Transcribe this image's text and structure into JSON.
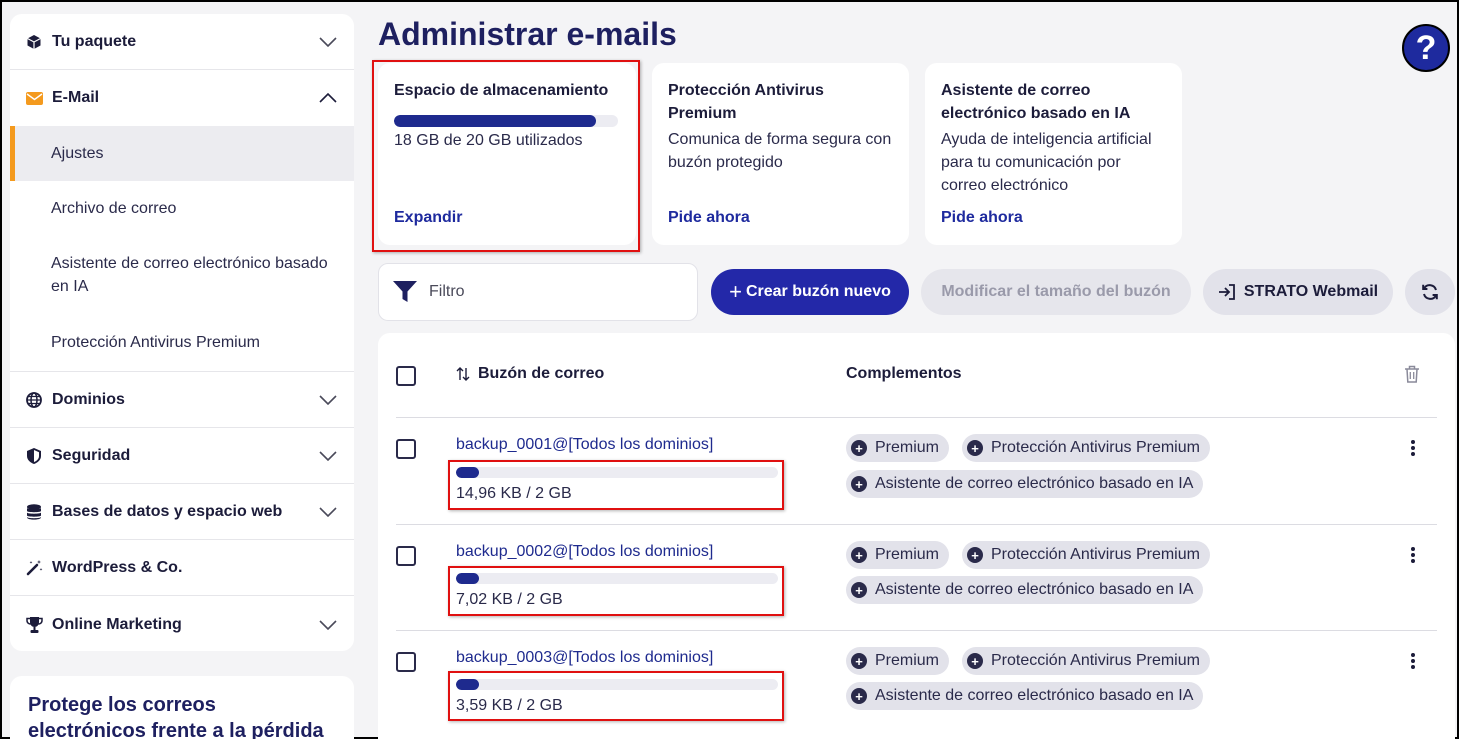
{
  "sidebar": {
    "items": [
      {
        "label": "Tu paquete",
        "icon": "package-icon",
        "expanded": false
      },
      {
        "label": "E-Mail",
        "icon": "envelope-icon",
        "expanded": true
      },
      {
        "label": "Dominios",
        "icon": "globe-icon",
        "expanded": false
      },
      {
        "label": "Seguridad",
        "icon": "shield-icon",
        "expanded": false
      },
      {
        "label": "Bases de datos y espacio web",
        "icon": "database-icon",
        "expanded": false
      },
      {
        "label": "WordPress & Co.",
        "icon": "magic-wand-icon"
      },
      {
        "label": "Online Marketing",
        "icon": "trophy-icon",
        "expanded": false
      }
    ],
    "email_subitems": [
      {
        "label": "Ajustes",
        "active": true
      },
      {
        "label": "Archivo de correo"
      },
      {
        "label": "Asistente de correo electrónico basado en IA"
      },
      {
        "label": "Protección Antivirus Premium"
      }
    ],
    "promo_text": "Protege los correos electrónicos frente a la pérdida de datos"
  },
  "header": {
    "title": "Administrar e-mails",
    "help_label": "?"
  },
  "cards": {
    "storage": {
      "title": "Espacio de almacenamiento",
      "usage": "18 GB de 20 GB utilizados",
      "used_fraction": 0.9,
      "link": "Expandir"
    },
    "antivirus": {
      "title": "Protección Antivirus Premium",
      "desc": "Comunica de forma segura con buzón protegido",
      "link": "Pide ahora"
    },
    "ai": {
      "title": "Asistente de correo electrónico basado en IA",
      "desc": "Ayuda de inteligencia artificial para tu comunicación por correo electrónico",
      "link": "Pide ahora"
    }
  },
  "toolbar": {
    "filter_placeholder": "Filtro",
    "create_label": "Crear buzón nuevo",
    "resize_label": "Modificar el tamaño del buzón",
    "webmail_label": "STRATO Webmail"
  },
  "table": {
    "columns": {
      "mailbox": "Buzón de correo",
      "addons": "Complementos"
    },
    "rows": [
      {
        "mailbox": "backup_0001@[Todos los dominios]",
        "size": "14,96 KB / 2 GB",
        "used_fraction": 0.07,
        "addons": [
          "Premium",
          "Protección Antivirus Premium",
          "Asistente de correo electrónico basado en IA"
        ]
      },
      {
        "mailbox": "backup_0002@[Todos los dominios]",
        "size": "7,02 KB / 2 GB",
        "used_fraction": 0.07,
        "addons": [
          "Premium",
          "Protección Antivirus Premium",
          "Asistente de correo electrónico basado en IA"
        ]
      },
      {
        "mailbox": "backup_0003@[Todos los dominios]",
        "size": "3,59 KB / 2 GB",
        "used_fraction": 0.07,
        "addons": [
          "Premium",
          "Protección Antivirus Premium",
          "Asistente de correo electrónico basado en IA"
        ]
      }
    ]
  },
  "colors": {
    "accent": "#2328a8",
    "active_marker": "#f49a1e",
    "highlight": "#e01010"
  }
}
